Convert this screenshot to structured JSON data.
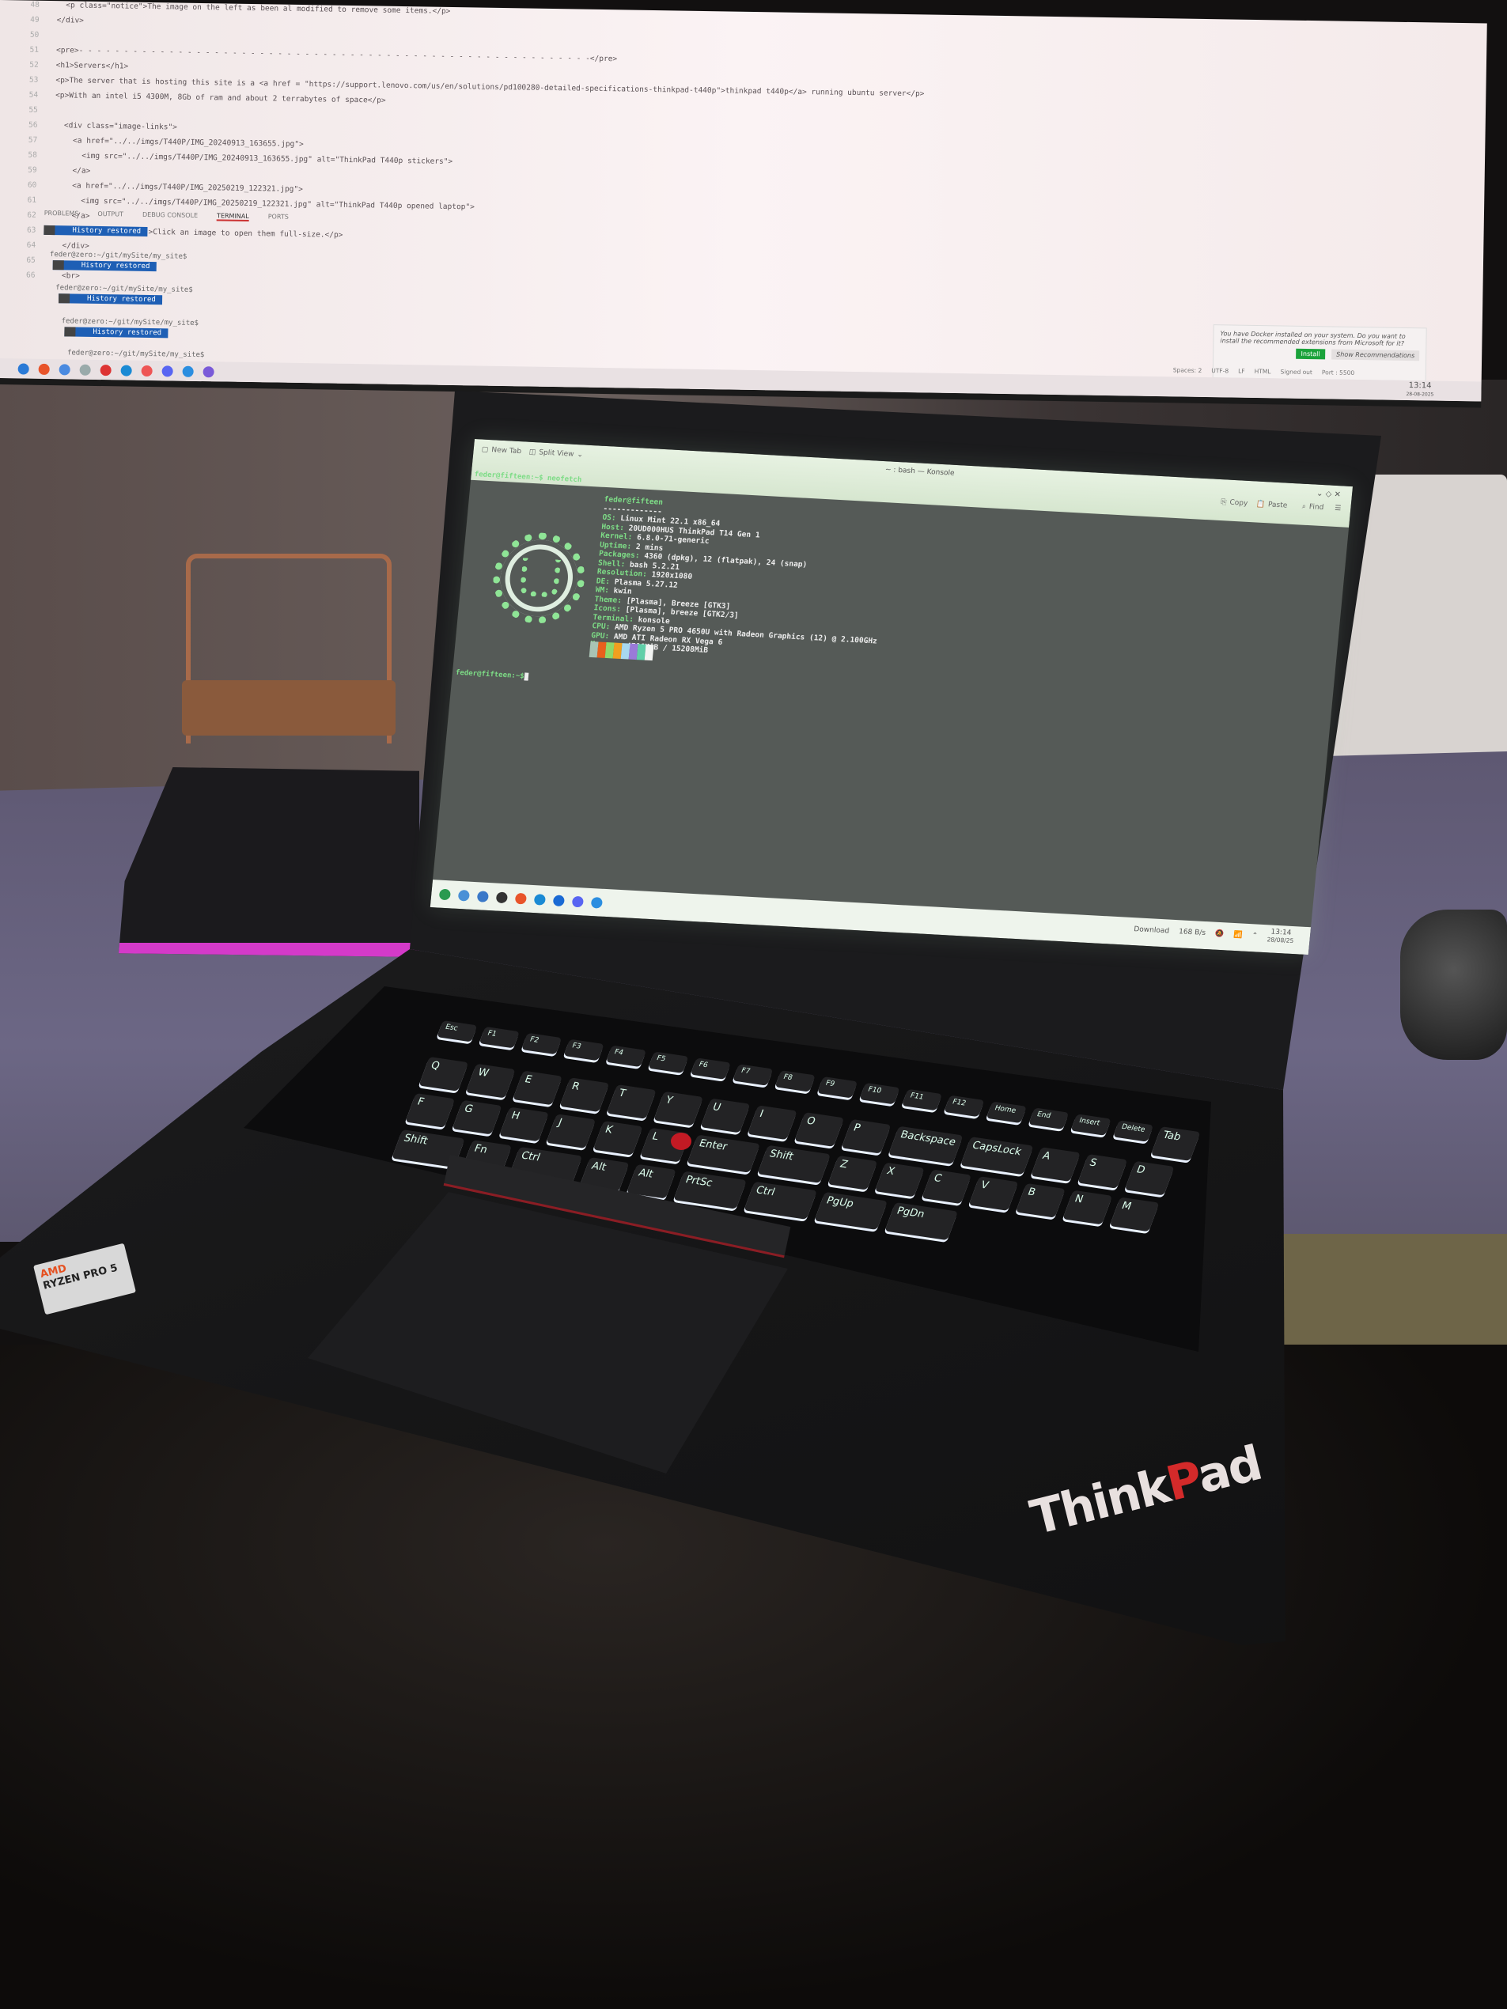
{
  "monitor": {
    "editor_lines": [
      {
        "n": "48",
        "t": "  <p class=\"notice\">The image on the left as been al modified to remove some items.</p>"
      },
      {
        "n": "49",
        "t": "</div>"
      },
      {
        "n": "50",
        "t": ""
      },
      {
        "n": "51",
        "t": "<pre>- - - - - - - - - - - - - - - - - - - - - - - - - - - - - - - - - - - - - - - - - - - - - - - - - - - - - - - - -</pre>"
      },
      {
        "n": "52",
        "t": "<h1>Servers</h1>"
      },
      {
        "n": "53",
        "t": "<p>The server that is hosting this site is a <a href = \"https://support.lenovo.com/us/en/solutions/pd100280-detailed-specifications-thinkpad-t440p\">thinkpad t440p</a> running ubuntu server</p>"
      },
      {
        "n": "54",
        "t": "<p>With an intel i5 4300M, 8Gb of ram and about 2 terrabytes of space</p>"
      },
      {
        "n": "55",
        "t": ""
      },
      {
        "n": "56",
        "t": "  <div class=\"image-links\">"
      },
      {
        "n": "57",
        "t": "    <a href=\"../../imgs/T440P/IMG_20240913_163655.jpg\">"
      },
      {
        "n": "58",
        "t": "      <img src=\"../../imgs/T440P/IMG_20240913_163655.jpg\" alt=\"ThinkPad T440p stickers\">"
      },
      {
        "n": "59",
        "t": "    </a>"
      },
      {
        "n": "60",
        "t": "    <a href=\"../../imgs/T440P/IMG_20250219_122321.jpg\">"
      },
      {
        "n": "61",
        "t": "      <img src=\"../../imgs/T440P/IMG_20250219_122321.jpg\" alt=\"ThinkPad T440p opened laptop\">"
      },
      {
        "n": "62",
        "t": "    </a>"
      },
      {
        "n": "63",
        "t": "    <p class=\"notice\">Click an image to open them full-size.</p>"
      },
      {
        "n": "64",
        "t": "  </div>"
      },
      {
        "n": "65",
        "t": ""
      },
      {
        "n": "66",
        "t": "  <br>"
      }
    ],
    "panel_tabs": [
      "PROBLEMS",
      "OUTPUT",
      "DEBUG CONSOLE",
      "TERMINAL",
      "PORTS"
    ],
    "history_label": "History restored",
    "prompt": "feder@zero:~/git/mySite/my_site$",
    "notification": {
      "text": "You have Docker installed on your system. Do you want to install the recommended extensions from Microsoft for it?",
      "install": "Install",
      "show": "Show Recommendations"
    },
    "status": [
      "Spaces: 2",
      "UTF-8",
      "LF",
      "HTML",
      "Signed out",
      "Port : 5500"
    ],
    "time": "13:14",
    "date": "28-08-2025"
  },
  "laptop": {
    "window_title": "~ : bash — Konsole",
    "toolbar": {
      "new_tab": "New Tab",
      "split_view": "Split View",
      "copy": "Copy",
      "paste": "Paste",
      "find": "Find"
    },
    "command_line": "feder@fifteen:~$ neofetch",
    "neofetch": {
      "user": "feder@fifteen",
      "sep": "-------------",
      "info": [
        {
          "k": "OS",
          "v": "Linux Mint 22.1 x86_64"
        },
        {
          "k": "Host",
          "v": "20UD000HUS ThinkPad T14 Gen 1"
        },
        {
          "k": "Kernel",
          "v": "6.8.0-71-generic"
        },
        {
          "k": "Uptime",
          "v": "2 mins"
        },
        {
          "k": "Packages",
          "v": "4360 (dpkg), 12 (flatpak), 24 (snap)"
        },
        {
          "k": "Shell",
          "v": "bash 5.2.21"
        },
        {
          "k": "Resolution",
          "v": "1920x1080"
        },
        {
          "k": "DE",
          "v": "Plasma 5.27.12"
        },
        {
          "k": "WM",
          "v": "kwin"
        },
        {
          "k": "Theme",
          "v": "[Plasma], Breeze [GTK3]"
        },
        {
          "k": "Icons",
          "v": "[Plasma], breeze [GTK2/3]"
        },
        {
          "k": "Terminal",
          "v": "konsole"
        },
        {
          "k": "CPU",
          "v": "AMD Ryzen 5 PRO 4650U with Radeon Graphics (12) @ 2.100GHz"
        },
        {
          "k": "GPU",
          "v": "AMD ATI Radeon RX Vega 6"
        },
        {
          "k": "Memory",
          "v": "4786MiB / 15208MiB"
        }
      ],
      "palette": [
        "#a9c3b4",
        "#e8601c",
        "#8fd86a",
        "#f0a020",
        "#a8d8f0",
        "#9a7ad8",
        "#5fcfa8",
        "#f2f4f2"
      ]
    },
    "prompt": "feder@fifteen:~$",
    "tray": {
      "download": "Download",
      "net_speed": "168 B/s",
      "time": "13:14",
      "date": "28/08/25"
    },
    "keys": [
      "Esc",
      "F1",
      "F2",
      "F3",
      "F4",
      "F5",
      "F6",
      "F7",
      "F8",
      "F9",
      "F10",
      "F11",
      "F12",
      "Home",
      "End",
      "Insert",
      "Delete",
      "Tab",
      "Q",
      "W",
      "E",
      "R",
      "T",
      "Y",
      "U",
      "I",
      "O",
      "P",
      "Backspace",
      "CapsLock",
      "A",
      "S",
      "D",
      "F",
      "G",
      "H",
      "J",
      "K",
      "L",
      "Enter",
      "Shift",
      "Z",
      "X",
      "C",
      "V",
      "B",
      "N",
      "M",
      "Shift",
      "Fn",
      "Ctrl",
      "Alt",
      "Alt",
      "PrtSc",
      "Ctrl",
      "PgUp",
      "PgDn"
    ]
  },
  "branding": {
    "thinkpad": "ThinkPad",
    "ryzen": "RYZEN PRO 5"
  }
}
